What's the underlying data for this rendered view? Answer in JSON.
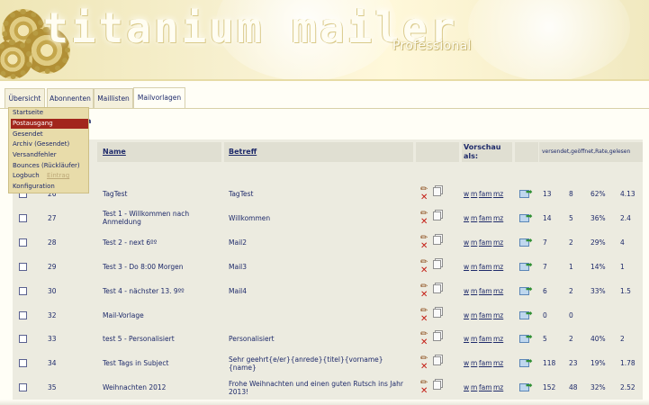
{
  "app": {
    "brand": "titanium mailer",
    "edition": "Professional"
  },
  "tabs": [
    {
      "label": "Übersicht",
      "active": false
    },
    {
      "label": "Abonnenten",
      "active": false
    },
    {
      "label": "Maillisten",
      "active": false
    },
    {
      "label": "Mailvorlagen",
      "active": true
    }
  ],
  "menu": {
    "items": [
      "Startseite",
      "Postausgang",
      "Gesendet",
      "Archiv (Gesendet)",
      "Versandfehler",
      "Bounces (Rückläufer)",
      "Logbuch",
      "Konfiguration"
    ],
    "highlighted_index": 1,
    "obscured_fragment": "Eintrag"
  },
  "page_fragment": "a",
  "table": {
    "headers": {
      "name": "Name",
      "subject": "Betreff",
      "preview_line1": "Vorschau",
      "preview_line2": "als:",
      "stats": "versendet,geöffnet,Rate,gelesen"
    },
    "preview_links": [
      "w",
      "m",
      "fam",
      "mz"
    ],
    "rows": [
      {
        "id": "26",
        "name": "TagTest",
        "subject": "TagTest",
        "sent": "13",
        "opened": "8",
        "rate": "62%",
        "read": "4.13"
      },
      {
        "id": "27",
        "name": "Test 1 - Willkommen nach Anmeldung",
        "subject": "Willkommen",
        "sent": "14",
        "opened": "5",
        "rate": "36%",
        "read": "2.4"
      },
      {
        "id": "28",
        "name": "Test 2 - next 6ºº",
        "subject": "Mail2",
        "sent": "7",
        "opened": "2",
        "rate": "29%",
        "read": "4"
      },
      {
        "id": "29",
        "name": "Test 3 - Do 8:00 Morgen",
        "subject": "Mail3",
        "sent": "7",
        "opened": "1",
        "rate": "14%",
        "read": "1"
      },
      {
        "id": "30",
        "name": "Test 4 - nächster 13. 9ºº",
        "subject": "Mail4",
        "sent": "6",
        "opened": "2",
        "rate": "33%",
        "read": "1.5"
      },
      {
        "id": "32",
        "name": "Mail-Vorlage",
        "subject": "",
        "sent": "0",
        "opened": "0",
        "rate": "",
        "read": ""
      },
      {
        "id": "33",
        "name": "test 5 - Personalisiert",
        "subject": "Personalisiert",
        "sent": "5",
        "opened": "2",
        "rate": "40%",
        "read": "2"
      },
      {
        "id": "34",
        "name": "Test Tags in Subject",
        "subject": "Sehr geehrt{e/er}{anrede}{titel}{vorname}{name}",
        "sent": "118",
        "opened": "23",
        "rate": "19%",
        "read": "1.78"
      },
      {
        "id": "35",
        "name": "Weihnachten 2012",
        "subject": "Frohe Weihnachten und einen guten Rutsch ins Jahr 2013!",
        "sent": "152",
        "opened": "48",
        "rate": "32%",
        "read": "2.52"
      }
    ]
  },
  "icons": {
    "edit": "pencil-icon",
    "delete": "delete-x-icon",
    "copy": "copy-icon",
    "send": "send-mail-icon"
  },
  "colors": {
    "menu_highlight": "#a2261c",
    "menu_bg": "#e8dcaa",
    "link": "#1e2a6a",
    "delete": "#c31b12"
  }
}
